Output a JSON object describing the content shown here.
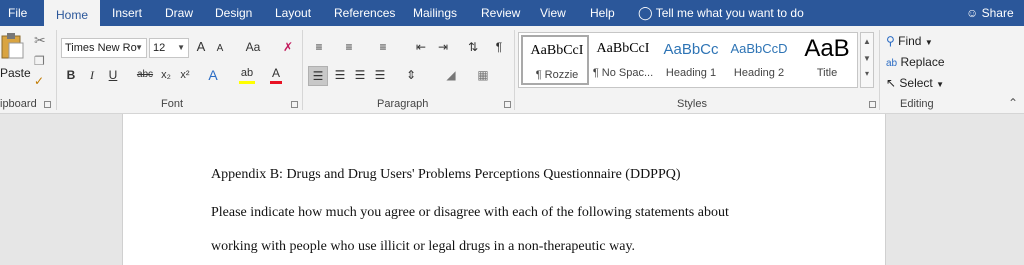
{
  "tabs": [
    {
      "label": "File"
    },
    {
      "label": "Home"
    },
    {
      "label": "Insert"
    },
    {
      "label": "Draw"
    },
    {
      "label": "Design"
    },
    {
      "label": "Layout"
    },
    {
      "label": "References"
    },
    {
      "label": "Mailings"
    },
    {
      "label": "Review"
    },
    {
      "label": "View"
    },
    {
      "label": "Help"
    }
  ],
  "tell_me": "Tell me what you want to do",
  "share": "Share",
  "clipboard": {
    "paste": "Paste",
    "label": "ipboard"
  },
  "font": {
    "name": "Times New Ro",
    "size": "12",
    "grow": "A",
    "shrink": "A",
    "case": "Aa",
    "bold": "B",
    "italic": "I",
    "underline": "U",
    "strike": "abc",
    "subscript": "x₂",
    "superscript": "x²",
    "effects": "A",
    "highlight": "ab",
    "color": "A",
    "label": "Font"
  },
  "paragraph": {
    "label": "Paragraph",
    "pilcrow": "¶"
  },
  "styles": {
    "label": "Styles",
    "items": [
      {
        "preview": "AaBbCcI",
        "name": "¶ Rozzie"
      },
      {
        "preview": "AaBbCcI",
        "name": "¶ No Spac..."
      },
      {
        "preview": "AaBbCc",
        "name": "Heading 1"
      },
      {
        "preview": "AaBbCcD",
        "name": "Heading 2"
      },
      {
        "preview": "AaB",
        "name": "Title"
      }
    ]
  },
  "editing": {
    "label": "Editing",
    "find": "Find",
    "replace": "Replace",
    "select": "Select"
  },
  "document": {
    "line1": "Appendix B: Drugs and Drug Users' Problems Perceptions Questionnaire (DDPPQ)",
    "line2": "Please indicate how much you agree or disagree with each of the following statements about",
    "line3": "working with people who use illicit or legal drugs in a non-therapeutic way."
  },
  "colors": {
    "accent": "#2b579a",
    "font_color_bar": "#e81123",
    "highlight_bar": "#ffff00",
    "heading_blue": "#2e74b5"
  }
}
